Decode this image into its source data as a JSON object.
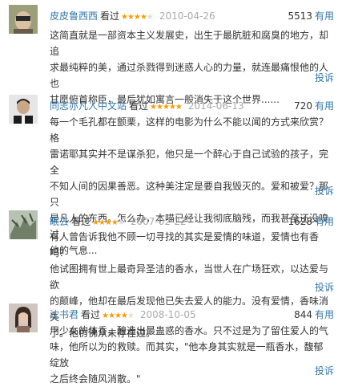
{
  "seen_label": "看过",
  "useful_label": "有用",
  "report_label": "投诉",
  "reviews": [
    {
      "user": "皮皮鲁西西",
      "rating": 4,
      "date": "2010-04-26",
      "votes": "5513",
      "avatar_icon": "avatar-photo-icon",
      "lines": [
        "这简直就是一部资本主义发展史，出生于最肮脏和腐臭的地方，却追",
        "求最纯粹的美，通过杀戮得到迷惑人心的力量，就连最痛恨他的人也",
        "甘愿俯首称臣，最后犹如寓言一般消失于这个世界......"
      ]
    },
    {
      "user": "同志亦凡人中文站",
      "rating": 5,
      "date": "2014-06-13",
      "votes": "720",
      "avatar_icon": "avatar-photo-icon",
      "lines": [
        "每一个毛孔都在颤栗，这样的电影为什么不能以闻的方式来欣赏？格",
        "雷诺耶其实并不是谋杀犯，他只是一个醉心于自己试验的孩子，完全",
        "不知人间的因果善恶。这种美注定是要自我毁灭的。爱和被爱？那只",
        "是凡人的东西。怎么办，本喵已经让我彻底脑残，而我甚至还没嗅过",
        "他的气息..."
      ]
    },
    {
      "user": "眠去",
      "rating": 4,
      "date": "2007-02-22",
      "votes": "1628",
      "avatar_icon": "avatar-photo-icon",
      "lines": [
        "有人曾告诉我他不顾一切寻找的其实是爱情的味道，爱情也有香吗？",
        "他试图拥有世上最奇异圣洁的香水，当世人在广场狂欢，以达爱与欲",
        "的颠峰，他却在最后发现他已失去爱人的能力。没有爱情，香味消失",
        "了。他仿佛从未存在过。"
      ]
    },
    {
      "user": "沈书君",
      "rating": 4,
      "date": "2008-10-05",
      "votes": "844",
      "avatar_icon": "avatar-photo-icon",
      "lines": [
        "用少女的体香，酿造出最蛊惑的香水。只不过是为了留住爱人的气",
        "味，他所以为的救赎。而其实，\"他本身其实就是一瓶香水，馥郁绽放",
        "之后终会随风消散。\""
      ]
    }
  ]
}
